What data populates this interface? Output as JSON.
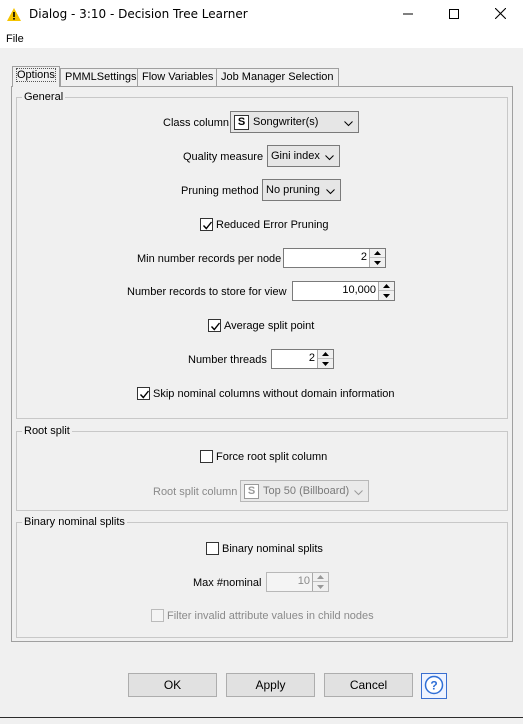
{
  "window": {
    "title": "Dialog - 3:10 - Decision Tree Learner",
    "warning_icon_color": "#f5c400"
  },
  "menu": {
    "file": "File"
  },
  "tabs": [
    {
      "label": "Options",
      "active": true
    },
    {
      "label": "PMMLSettings"
    },
    {
      "label": "Flow Variables"
    },
    {
      "label": "Job Manager Selection"
    }
  ],
  "general": {
    "title": "General",
    "class_column_label": "Class column",
    "class_column_badge": "S",
    "class_column_value": "Songwriter(s)",
    "quality_measure_label": "Quality measure",
    "quality_measure_value": "Gini index",
    "pruning_method_label": "Pruning method",
    "pruning_method_value": "No pruning",
    "reduced_error_pruning_label": "Reduced Error Pruning",
    "reduced_error_pruning_checked": true,
    "min_records_label": "Min number records per node",
    "min_records_value": "2",
    "records_store_label": "Number records to store for view",
    "records_store_value": "10,000",
    "average_split_label": "Average split point",
    "average_split_checked": true,
    "threads_label": "Number threads",
    "threads_value": "2",
    "skip_nominal_label": "Skip nominal columns without domain information",
    "skip_nominal_checked": true
  },
  "root_split": {
    "title": "Root split",
    "force_label": "Force root split column",
    "force_checked": false,
    "column_label": "Root split column",
    "column_badge": "S",
    "column_value": "Top 50 (Billboard)"
  },
  "binary": {
    "title": "Binary nominal splits",
    "binary_label": "Binary nominal splits",
    "binary_checked": false,
    "max_nominal_label": "Max #nominal",
    "max_nominal_value": "10",
    "filter_label": "Filter invalid attribute values in child nodes",
    "filter_checked": false
  },
  "buttons": {
    "ok": "OK",
    "apply": "Apply",
    "cancel": "Cancel",
    "help_symbol": "?"
  }
}
